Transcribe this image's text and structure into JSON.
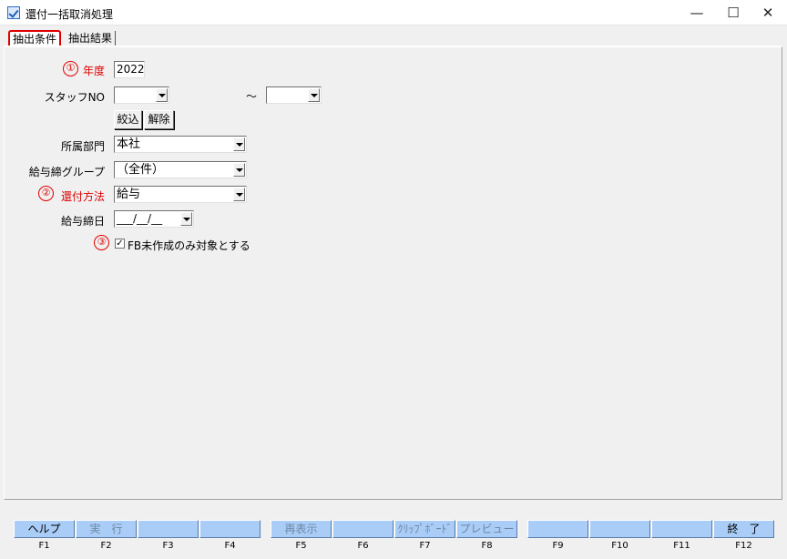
{
  "window": {
    "title": "還付一括取消処理",
    "minimize": "—",
    "maximize": "☐",
    "close": "✕"
  },
  "tabs": [
    {
      "label": "抽出条件",
      "active": true
    },
    {
      "label": "抽出結果",
      "active": false
    }
  ],
  "form": {
    "year": {
      "marker": "①",
      "label": "年度",
      "value": "2022"
    },
    "staff": {
      "label": "スタッフNO",
      "from": "",
      "to": "",
      "tilde": "～"
    },
    "filter_buttons": {
      "narrow": "絞込",
      "clear": "解除"
    },
    "department": {
      "label": "所属部門",
      "value": "本社"
    },
    "payroll_group": {
      "label": "給与締グループ",
      "value": "（全件）"
    },
    "refund_method": {
      "marker": "②",
      "label": "還付方法",
      "value": "給与"
    },
    "closing_date": {
      "label": "給与締日",
      "value": "___/__/__"
    },
    "fb_only": {
      "marker": "③",
      "checked": true,
      "check_glyph": "✓",
      "label": "FB未作成のみ対象とする"
    }
  },
  "function_keys": [
    {
      "key": "F1",
      "label": "ヘルプ",
      "enabled": true
    },
    {
      "key": "F2",
      "label": "実　行",
      "enabled": false
    },
    {
      "key": "F3",
      "label": "",
      "enabled": false
    },
    {
      "key": "F4",
      "label": "",
      "enabled": false
    },
    {
      "key": "F5",
      "label": "再表示",
      "enabled": false
    },
    {
      "key": "F6",
      "label": "",
      "enabled": false
    },
    {
      "key": "F7",
      "label": "ｸﾘｯﾌﾟﾎﾞｰﾄﾞ",
      "enabled": false
    },
    {
      "key": "F8",
      "label": "プレビュー",
      "enabled": false
    },
    {
      "key": "F9",
      "label": "",
      "enabled": false
    },
    {
      "key": "F10",
      "label": "",
      "enabled": false
    },
    {
      "key": "F11",
      "label": "",
      "enabled": false
    },
    {
      "key": "F12",
      "label": "終　了",
      "enabled": true
    }
  ],
  "colors": {
    "accent_red": "#e00000",
    "fkey_blue": "#a9cdf7"
  }
}
